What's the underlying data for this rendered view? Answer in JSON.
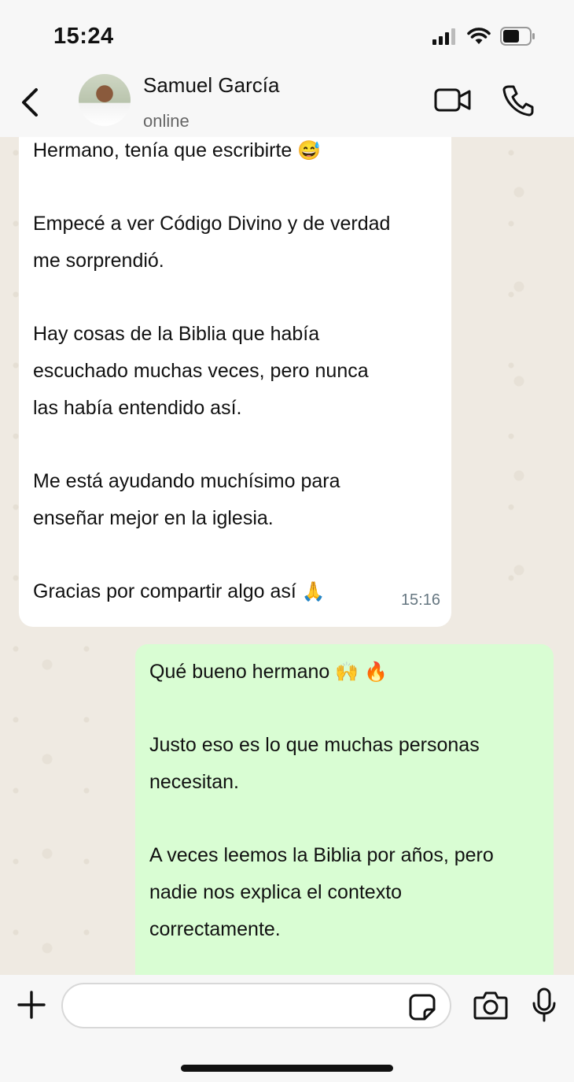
{
  "status_bar": {
    "time": "15:24"
  },
  "header": {
    "contact_name": "Samuel García",
    "contact_status": "online"
  },
  "messages": {
    "incoming": {
      "lines": [
        "Hermano, tenía que escribirte",
        "",
        "Empecé a ver Código Divino y de verdad",
        "me sorprendió.",
        "",
        "Hay cosas de la Biblia que había",
        "escuchado muchas veces, pero nunca",
        "las había entendido así.",
        "",
        "Me está ayudando muchísimo para",
        "enseñar mejor en la iglesia.",
        "",
        "Gracias por compartir algo así"
      ],
      "time": "15:16"
    },
    "outgoing": {
      "lines": [
        "Qué bueno hermano",
        "",
        "Justo eso es lo que muchas personas",
        "necesitan.",
        "",
        "A veces leemos la Biblia por años, pero",
        "nadie nos explica el contexto",
        "correctamente."
      ]
    }
  },
  "icons": {
    "incoming_first_emoji": "😅",
    "incoming_last_emoji": "🙏",
    "outgoing_emoji_1": "🙌",
    "outgoing_emoji_2": "🔥"
  },
  "input": {
    "placeholder": ""
  },
  "colors": {
    "incoming_bubble": "#ffffff",
    "outgoing_bubble": "#d9fdd3",
    "chat_background": "#efeae2"
  }
}
